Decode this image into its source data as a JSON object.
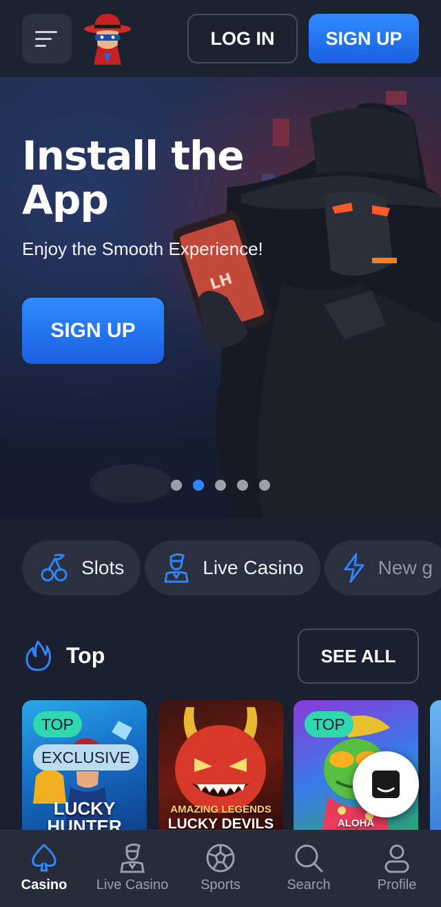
{
  "header": {
    "menu_icon": "hamburger-icon",
    "logo": "masked-hunter-logo",
    "login_label": "LOG IN",
    "signup_label": "SIGN UP"
  },
  "hero": {
    "title": "Install the App",
    "subtitle": "Enjoy the Smooth Experience!",
    "cta_label": "SIGN UP",
    "phone_text": "LH",
    "slides_total": 5,
    "active_slide": 2
  },
  "categories": [
    {
      "label": "Slots",
      "icon": "cherries-icon"
    },
    {
      "label": "Live Casino",
      "icon": "dealer-icon"
    },
    {
      "label": "New g",
      "icon": "lightning-icon"
    }
  ],
  "top_section": {
    "title": "Top",
    "icon": "flame-icon",
    "see_all_label": "SEE ALL"
  },
  "games": [
    {
      "name": "LUCKY HUNTER",
      "badges": [
        "TOP",
        "EXCLUSIVE"
      ]
    },
    {
      "subtitle": "AMAZING LEGENDS",
      "name": "LUCKY DEVILS",
      "badges": []
    },
    {
      "name": "ALOHA",
      "badges": [
        "TOP"
      ]
    }
  ],
  "chat": {
    "icon": "chat-icon"
  },
  "bottom_nav": [
    {
      "label": "Casino",
      "icon": "spade-icon",
      "active": true
    },
    {
      "label": "Live Casino",
      "icon": "dealer-icon",
      "active": false
    },
    {
      "label": "Sports",
      "icon": "soccer-ball-icon",
      "active": false
    },
    {
      "label": "Search",
      "icon": "search-icon",
      "active": false
    },
    {
      "label": "Profile",
      "icon": "user-icon",
      "active": false
    }
  ],
  "colors": {
    "accent": "#2f86ff",
    "background": "#1b2030",
    "badge_top": "#2fd8b0",
    "badge_exclusive": "#b9dcf2"
  }
}
